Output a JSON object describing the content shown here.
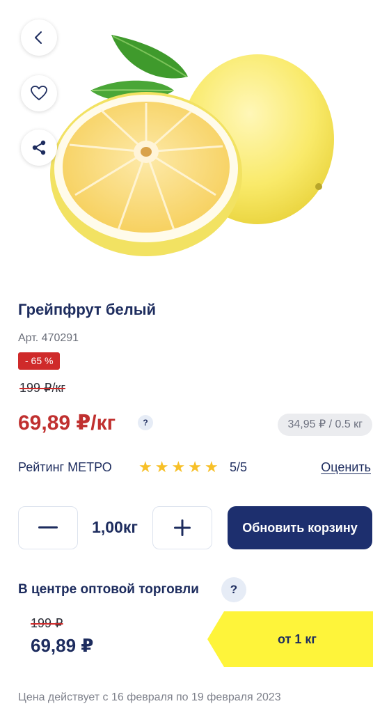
{
  "product": {
    "title": "Грейпфрут белый",
    "article": "Арт. 470291",
    "discount": "- 65 %",
    "old_price": "199 ₽/кг",
    "new_price": "69,89 ₽/кг",
    "price_hint": "?",
    "unit_price": "34,95 ₽ / 0.5 кг"
  },
  "rating": {
    "label": "Рейтинг МЕТРО",
    "value": "5/5",
    "stars_filled": 5,
    "stars_total": 5,
    "rate_link": "Оценить"
  },
  "cart": {
    "minus": "−",
    "quantity": "1,00кг",
    "plus": "+",
    "update_button": "Обновить корзину"
  },
  "wholesale": {
    "title": "В центре оптовой торговли",
    "hint": "?",
    "old_price": "199 ₽",
    "new_price": "69,89 ₽",
    "tier_label": "от 1 кг",
    "validity": "Цена действует с 16 февраля по 19 февраля 2023"
  },
  "icons": {
    "back": "chevron-left-icon",
    "favorite": "heart-icon",
    "share": "share-icon"
  },
  "colors": {
    "brand_navy": "#1d2f6e",
    "sale_red": "#cf2a2a",
    "star_yellow": "#f7c028",
    "tier_yellow": "#fef43a"
  }
}
